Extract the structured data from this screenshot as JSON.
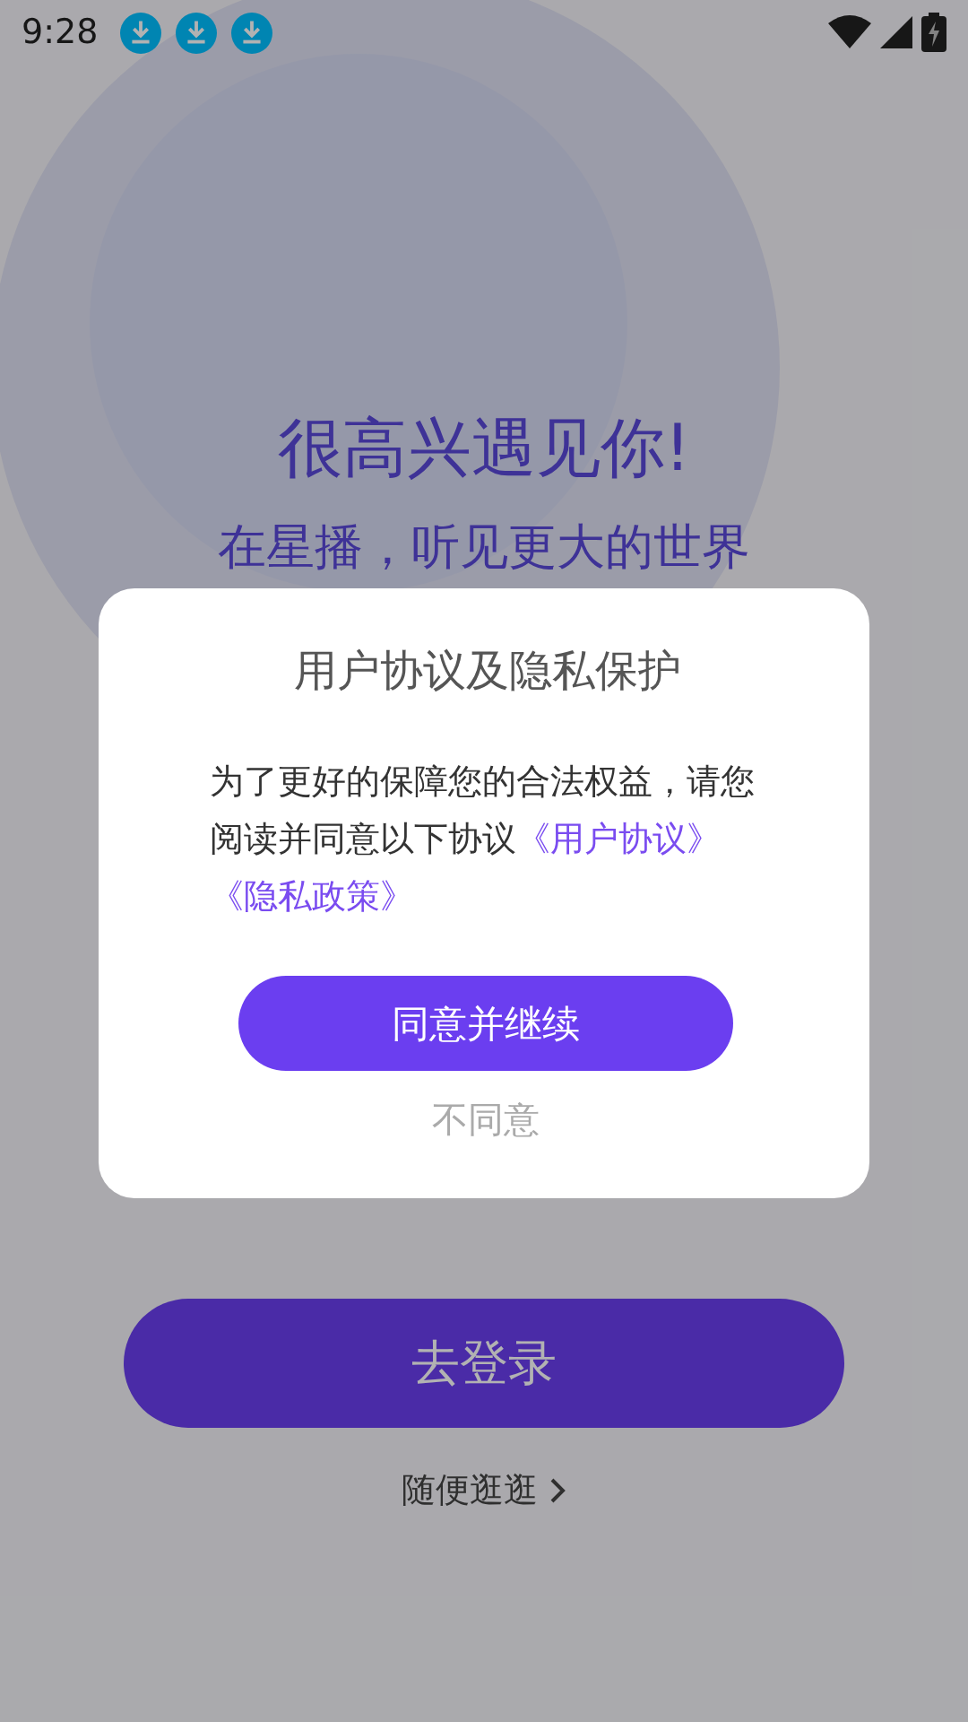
{
  "status_bar": {
    "time": "9:28"
  },
  "headline": "很高兴遇见你!",
  "tagline": "在星播，听见更大的世界",
  "login_button": "去登录",
  "browse_link": "随便逛逛",
  "dialog": {
    "title": "用户协议及隐私保护",
    "message": "为了更好的保障您的合法权益，请您阅读并同意以下协议",
    "links": [
      "《用户协议》",
      "《隐私政策》"
    ],
    "agree_button": "同意并继续",
    "decline_button": "不同意"
  }
}
